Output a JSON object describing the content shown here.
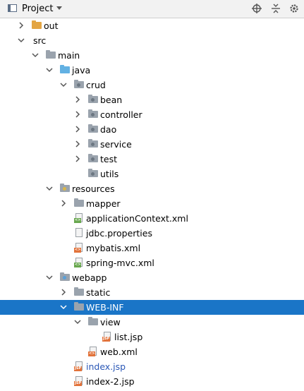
{
  "header": {
    "title": "Project"
  },
  "colors": {
    "selection": "#1a75c7",
    "folder": "#9aa3ad",
    "source_folder": "#62b1e3",
    "orange_folder": "#e3a543",
    "jsp_badge": "#e2733b"
  },
  "tree": [
    {
      "label": "out",
      "icon": "folder-orange-icon",
      "arrow": "right"
    },
    {
      "label": "src",
      "icon": "none",
      "arrow": "down"
    },
    {
      "label": "main",
      "icon": "folder-icon",
      "arrow": "down"
    },
    {
      "label": "java",
      "icon": "source-folder-icon",
      "arrow": "down"
    },
    {
      "label": "crud",
      "icon": "package-icon",
      "arrow": "down"
    },
    {
      "label": "bean",
      "icon": "package-icon",
      "arrow": "right"
    },
    {
      "label": "controller",
      "icon": "package-icon",
      "arrow": "right"
    },
    {
      "label": "dao",
      "icon": "package-icon",
      "arrow": "right"
    },
    {
      "label": "service",
      "icon": "package-icon",
      "arrow": "right"
    },
    {
      "label": "test",
      "icon": "package-icon",
      "arrow": "right"
    },
    {
      "label": "utils",
      "icon": "package-icon",
      "arrow": "none"
    },
    {
      "label": "resources",
      "icon": "resources-folder-icon",
      "arrow": "down"
    },
    {
      "label": "mapper",
      "icon": "folder-icon",
      "arrow": "right"
    },
    {
      "label": "applicationContext.xml",
      "icon": "spring-xml-file-icon",
      "arrow": "none"
    },
    {
      "label": "jdbc.properties",
      "icon": "properties-file-icon",
      "arrow": "none"
    },
    {
      "label": "mybatis.xml",
      "icon": "xml-file-icon",
      "arrow": "none"
    },
    {
      "label": "spring-mvc.xml",
      "icon": "spring-xml-file-icon",
      "arrow": "none"
    },
    {
      "label": "webapp",
      "icon": "web-folder-icon",
      "arrow": "down"
    },
    {
      "label": "static",
      "icon": "folder-icon",
      "arrow": "right"
    },
    {
      "label": "WEB-INF",
      "icon": "folder-icon",
      "arrow": "down",
      "selected": true
    },
    {
      "label": "view",
      "icon": "folder-icon",
      "arrow": "down"
    },
    {
      "label": "list.jsp",
      "icon": "jsp-file-icon",
      "arrow": "none"
    },
    {
      "label": "web.xml",
      "icon": "xml-file-icon",
      "arrow": "none"
    },
    {
      "label": "index.jsp",
      "icon": "jsp-file-icon",
      "arrow": "none",
      "modified": true
    },
    {
      "label": "index-2.jsp",
      "icon": "jsp-file-icon",
      "arrow": "none"
    }
  ]
}
